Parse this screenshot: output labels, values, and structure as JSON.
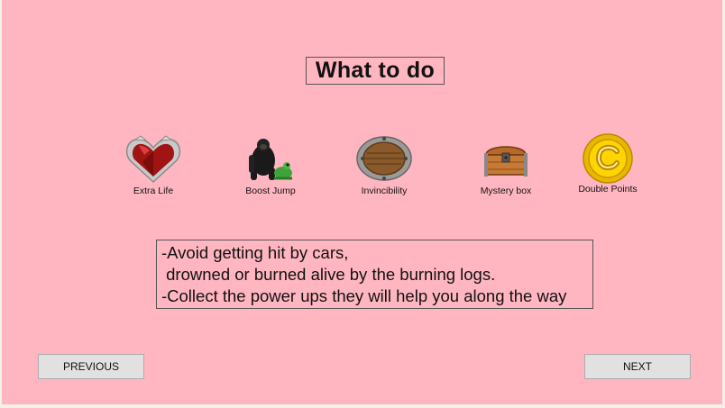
{
  "screen": {
    "title": "What to do",
    "background_color": "#ffb6c1"
  },
  "powerups": [
    {
      "label": "Extra Life",
      "icon": "heart-shield-icon"
    },
    {
      "label": "Boost Jump",
      "icon": "gorilla-frog-icon"
    },
    {
      "label": "Invincibility",
      "icon": "round-shield-icon"
    },
    {
      "label": "Mystery box",
      "icon": "treasure-chest-icon"
    },
    {
      "label": "Double Points",
      "icon": "gold-coin-icon"
    }
  ],
  "instructions": {
    "line1": "-Avoid getting hit by cars,",
    "line2": " drowned or burned alive by the burning logs.",
    "line3": "-Collect the power ups they will help you along the way"
  },
  "buttons": {
    "previous": "PREVIOUS",
    "next": "NEXT"
  }
}
